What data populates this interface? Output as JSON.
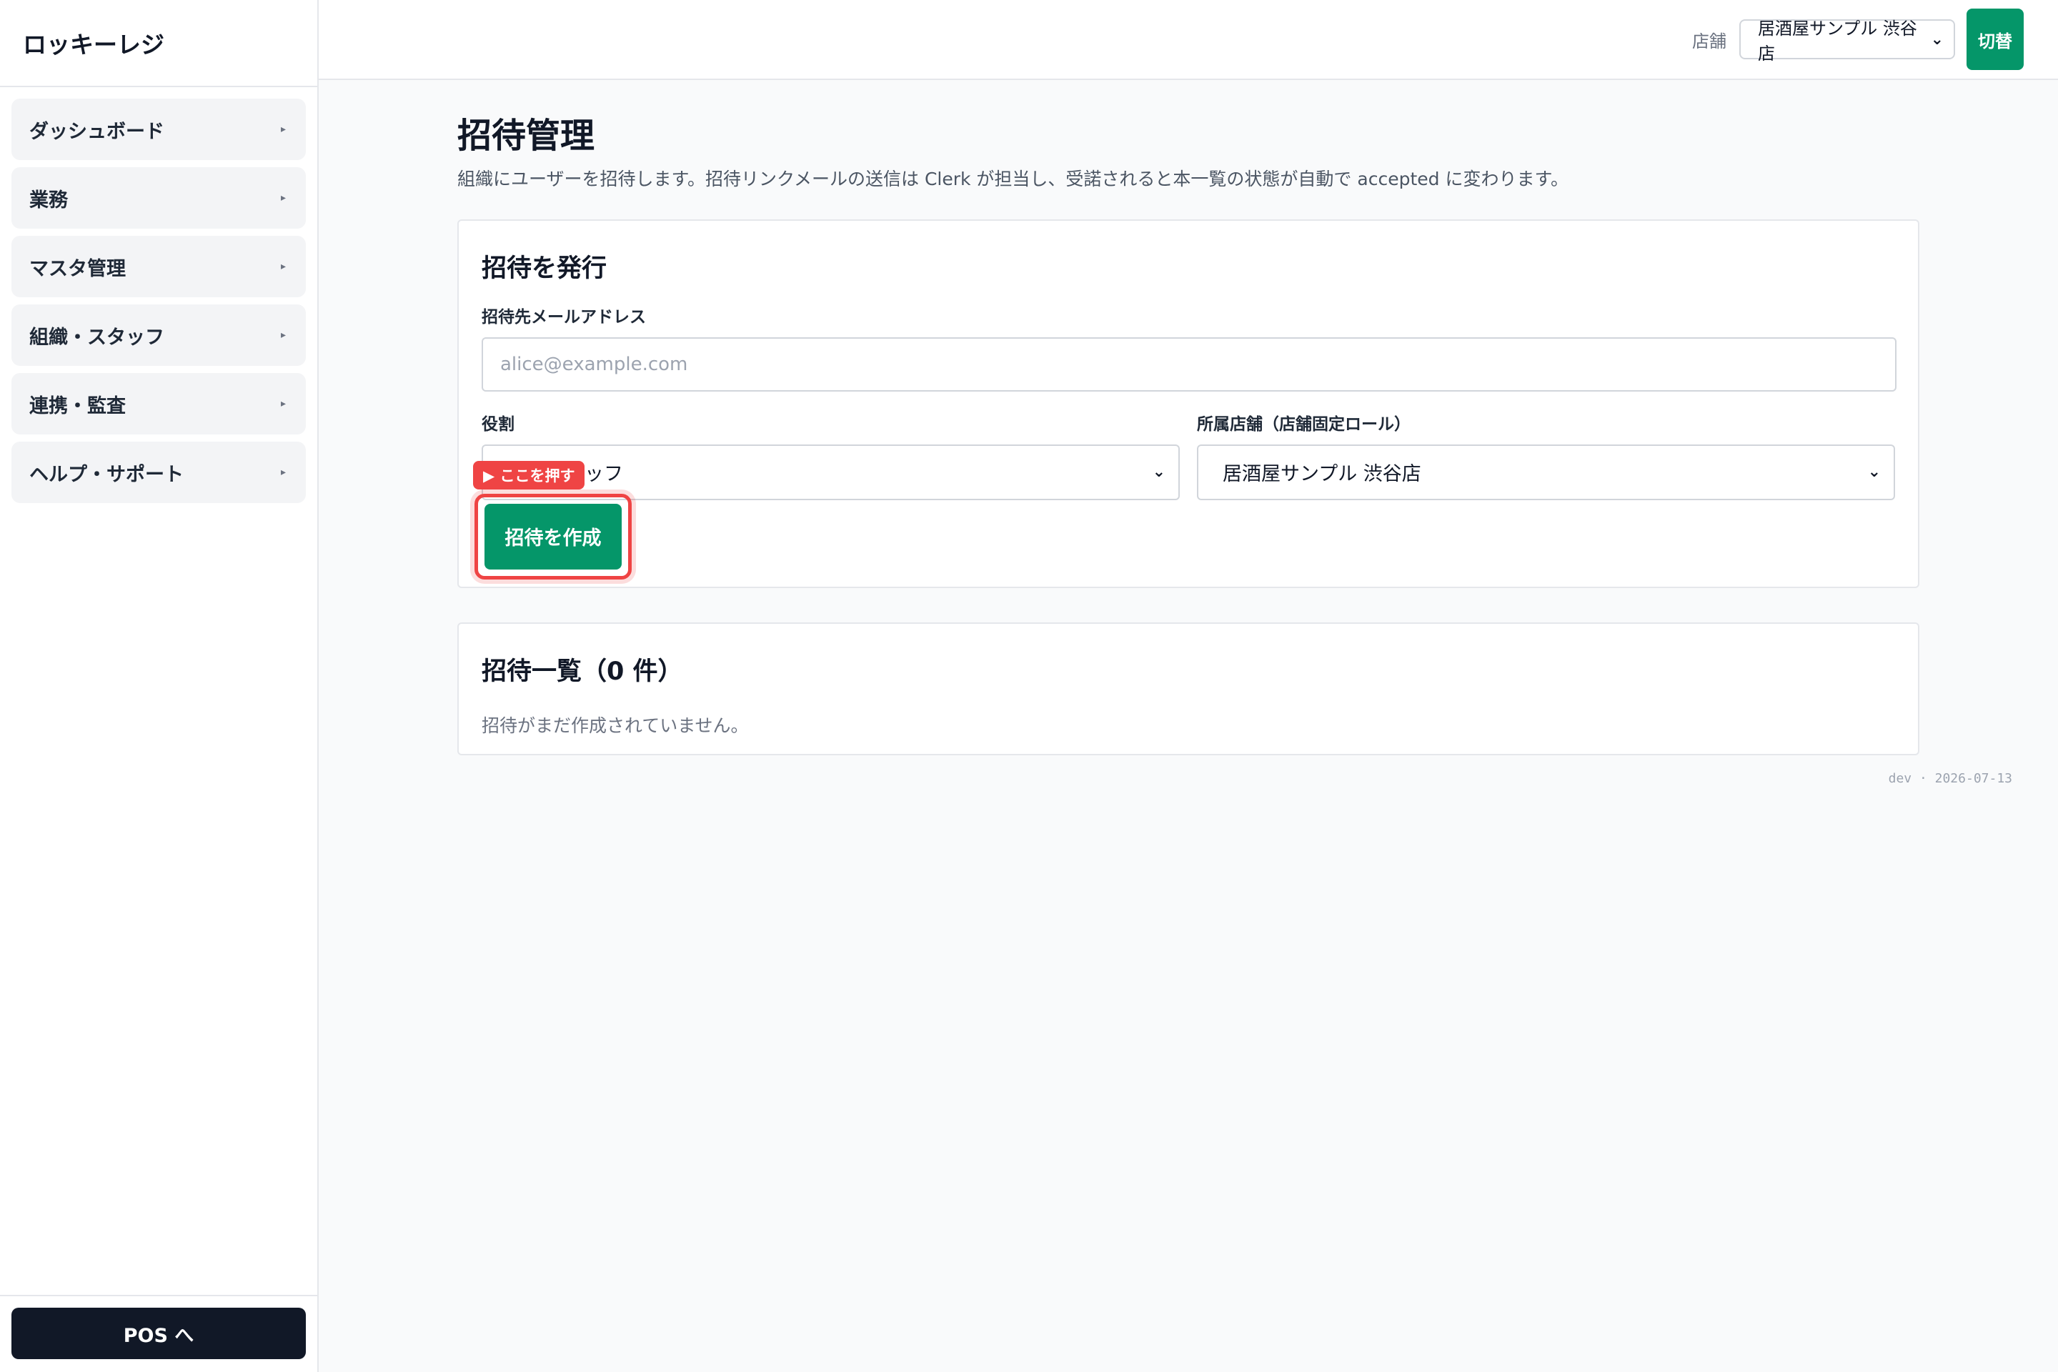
{
  "app": {
    "brand": "ロッキーレジ"
  },
  "sidebar": {
    "items": [
      {
        "label": "ダッシュボード",
        "caret": "▸"
      },
      {
        "label": "業務",
        "caret": "▸"
      },
      {
        "label": "マスタ管理",
        "caret": "▸"
      },
      {
        "label": "組織・スタッフ",
        "caret": "▸"
      },
      {
        "label": "連携・監査",
        "caret": "▸"
      },
      {
        "label": "ヘルプ・サポート",
        "caret": "▸"
      }
    ],
    "pos_label": "POS へ"
  },
  "topbar": {
    "store_label": "店舗",
    "store_value": "居酒屋サンプル 渋谷店",
    "switch_label": "切替"
  },
  "page": {
    "title": "招待管理",
    "description": "組織にユーザーを招待します。招待リンクメールの送信は Clerk が担当し、受諾されると本一覧の状態が自動で accepted に変わります。"
  },
  "invite_form": {
    "title": "招待を発行",
    "email_label": "招待先メールアドレス",
    "email_placeholder": "alice@example.com",
    "email_value": "",
    "role_label": "役割",
    "role_value": "店舗スタッフ",
    "store_label": "所属店舗（店舗固定ロール）",
    "store_value": "居酒屋サンプル 渋谷店",
    "hint_label": "▶ ここを押す",
    "create_label": "招待を作成"
  },
  "invite_list": {
    "title": "招待一覧（0 件）",
    "empty_text": "招待がまだ作成されていません。"
  },
  "footer": {
    "meta": "dev · 2026-07-13"
  },
  "colors": {
    "accent": "#059669",
    "highlight": "#ef4444",
    "dark": "#111827"
  }
}
